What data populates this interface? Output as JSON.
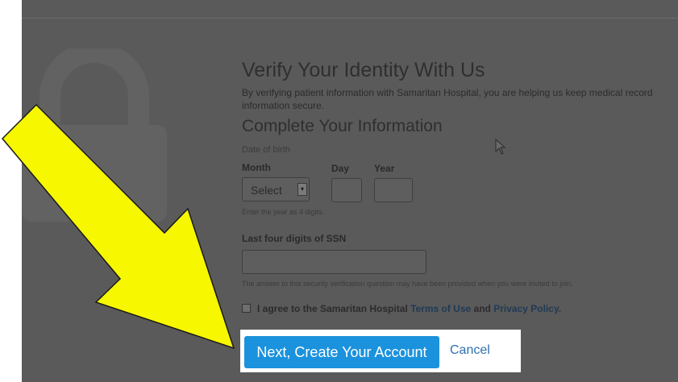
{
  "verify": {
    "title": "Verify Your Identity With Us",
    "description": "By verifying patient information with Samaritan Hospital, you are helping us keep medical record information secure."
  },
  "info": {
    "title": "Complete Your Information",
    "dob_label": "Date of birth",
    "month_label": "Month",
    "day_label": "Day",
    "year_label": "Year",
    "month_value": "Select",
    "year_hint": "Enter the year as 4 digits.",
    "ssn_label": "Last four digits of SSN",
    "ssn_hint": "The answer to this security verification question may have been provided when you were invited to join."
  },
  "agreement": {
    "prefix": "I agree to the Samaritan Hospital",
    "terms_link": "Terms of Use",
    "and": "and",
    "privacy_link": "Privacy Policy."
  },
  "actions": {
    "next_label": "Next, Create Your Account",
    "cancel_label": "Cancel"
  },
  "colors": {
    "primary_button": "#1b92dd",
    "overlay": "#5a5a5a",
    "arrow_fill": "#f7f700"
  },
  "icons": [
    "lock-icon",
    "mouse-cursor-icon",
    "yellow-arrow-annotation",
    "select-caret-icon"
  ]
}
